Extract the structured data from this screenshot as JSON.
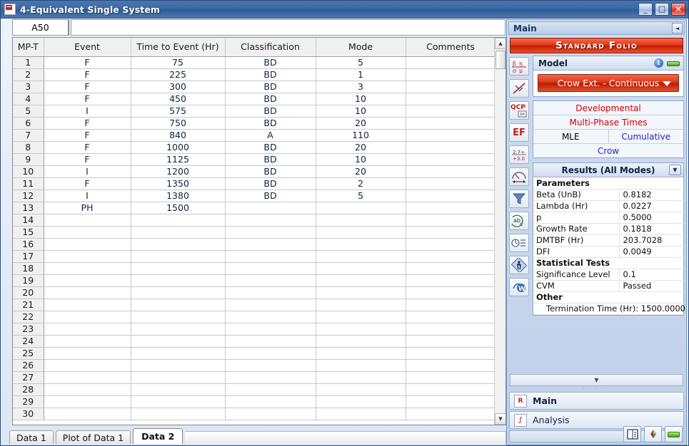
{
  "window": {
    "title": "4-Equivalent Single System",
    "app_icon": "reliasoft-icon",
    "buttons": {
      "minimize": "_",
      "maximize": "□",
      "close": "✕"
    }
  },
  "formula_bar": {
    "cell_ref": "A50",
    "value": "",
    "placeholder": ""
  },
  "grid": {
    "columns": [
      "MP-T",
      "Event",
      "Time to Event (Hr)",
      "Classification",
      "Mode",
      "Comments"
    ],
    "rows": [
      {
        "n": "1",
        "event": "F",
        "time": "75",
        "classification": "BD",
        "mode": "5",
        "comments": ""
      },
      {
        "n": "2",
        "event": "F",
        "time": "225",
        "classification": "BD",
        "mode": "1",
        "comments": ""
      },
      {
        "n": "3",
        "event": "F",
        "time": "300",
        "classification": "BD",
        "mode": "3",
        "comments": ""
      },
      {
        "n": "4",
        "event": "F",
        "time": "450",
        "classification": "BD",
        "mode": "10",
        "comments": ""
      },
      {
        "n": "5",
        "event": "I",
        "time": "575",
        "classification": "BD",
        "mode": "10",
        "comments": ""
      },
      {
        "n": "6",
        "event": "F",
        "time": "750",
        "classification": "BD",
        "mode": "20",
        "comments": ""
      },
      {
        "n": "7",
        "event": "F",
        "time": "840",
        "classification": "A",
        "mode": "110",
        "comments": ""
      },
      {
        "n": "8",
        "event": "F",
        "time": "1000",
        "classification": "BD",
        "mode": "20",
        "comments": ""
      },
      {
        "n": "9",
        "event": "F",
        "time": "1125",
        "classification": "BD",
        "mode": "10",
        "comments": ""
      },
      {
        "n": "10",
        "event": "I",
        "time": "1200",
        "classification": "BD",
        "mode": "20",
        "comments": ""
      },
      {
        "n": "11",
        "event": "F",
        "time": "1350",
        "classification": "BD",
        "mode": "2",
        "comments": ""
      },
      {
        "n": "12",
        "event": "I",
        "time": "1380",
        "classification": "BD",
        "mode": "5",
        "comments": ""
      },
      {
        "n": "13",
        "event": "PH",
        "time": "1500",
        "classification": "",
        "mode": "",
        "comments": ""
      },
      {
        "n": "14",
        "event": "",
        "time": "",
        "classification": "",
        "mode": "",
        "comments": ""
      },
      {
        "n": "15",
        "event": "",
        "time": "",
        "classification": "",
        "mode": "",
        "comments": ""
      },
      {
        "n": "16",
        "event": "",
        "time": "",
        "classification": "",
        "mode": "",
        "comments": ""
      },
      {
        "n": "17",
        "event": "",
        "time": "",
        "classification": "",
        "mode": "",
        "comments": ""
      },
      {
        "n": "18",
        "event": "",
        "time": "",
        "classification": "",
        "mode": "",
        "comments": ""
      },
      {
        "n": "19",
        "event": "",
        "time": "",
        "classification": "",
        "mode": "",
        "comments": ""
      },
      {
        "n": "20",
        "event": "",
        "time": "",
        "classification": "",
        "mode": "",
        "comments": ""
      },
      {
        "n": "21",
        "event": "",
        "time": "",
        "classification": "",
        "mode": "",
        "comments": ""
      },
      {
        "n": "22",
        "event": "",
        "time": "",
        "classification": "",
        "mode": "",
        "comments": ""
      },
      {
        "n": "23",
        "event": "",
        "time": "",
        "classification": "",
        "mode": "",
        "comments": ""
      },
      {
        "n": "24",
        "event": "",
        "time": "",
        "classification": "",
        "mode": "",
        "comments": ""
      },
      {
        "n": "25",
        "event": "",
        "time": "",
        "classification": "",
        "mode": "",
        "comments": ""
      },
      {
        "n": "26",
        "event": "",
        "time": "",
        "classification": "",
        "mode": "",
        "comments": ""
      },
      {
        "n": "27",
        "event": "",
        "time": "",
        "classification": "",
        "mode": "",
        "comments": ""
      },
      {
        "n": "28",
        "event": "",
        "time": "",
        "classification": "",
        "mode": "",
        "comments": ""
      },
      {
        "n": "29",
        "event": "",
        "time": "",
        "classification": "",
        "mode": "",
        "comments": ""
      },
      {
        "n": "30",
        "event": "",
        "time": "",
        "classification": "",
        "mode": "",
        "comments": ""
      }
    ]
  },
  "sheet_tabs": [
    {
      "label": "Data 1",
      "active": false
    },
    {
      "label": "Plot of Data 1",
      "active": false
    },
    {
      "label": "Data 2",
      "active": true
    }
  ],
  "panel": {
    "header_title": "Main",
    "collapse_glyph": "◄",
    "banner": "Standard Folio",
    "icon_rail": [
      "parameters-icon",
      "plot-icon",
      "qcp-icon",
      "ef-icon",
      "calculator-icon",
      "gauge-icon",
      "funnel-icon",
      "abc-transform-icon",
      "timeline-icon",
      "runner-icon",
      "word-export-icon"
    ],
    "model": {
      "title": "Model",
      "info_icon": "info-icon",
      "green_icon": "green-bar-icon",
      "selected": "Crow Ext. - Continuous",
      "dropdown_arrow": "chevron-down-icon"
    },
    "options": {
      "developmental": "Developmental",
      "multi_phase_times": "Multi-Phase Times",
      "mle": "MLE",
      "cumulative": "Cumulative",
      "crow": "Crow"
    },
    "results": {
      "title": "Results (All Modes)",
      "chevron": "chevron-down-icon",
      "rows": [
        {
          "kind": "section",
          "label": "Parameters",
          "value": ""
        },
        {
          "kind": "item",
          "label": "Beta (UnB)",
          "value": "0.8182"
        },
        {
          "kind": "item",
          "label": "Lambda (Hr)",
          "value": "0.0227"
        },
        {
          "kind": "item",
          "label": "p",
          "value": "0.5000"
        },
        {
          "kind": "item",
          "label": "Growth Rate",
          "value": "0.1818"
        },
        {
          "kind": "item",
          "label": "DMTBF (Hr)",
          "value": "203.7028"
        },
        {
          "kind": "item",
          "label": "DFI",
          "value": "0.0049"
        },
        {
          "kind": "section",
          "label": "Statistical Tests",
          "value": ""
        },
        {
          "kind": "item",
          "label": "Significance Level",
          "value": "0.1"
        },
        {
          "kind": "item",
          "label": "CVM",
          "value": "Passed"
        },
        {
          "kind": "section",
          "label": "Other",
          "value": ""
        },
        {
          "kind": "wide",
          "label": "Termination Time (Hr): 1500.0000",
          "value": ""
        }
      ]
    },
    "resize_glyph": "▼",
    "dots": "· · · · ·",
    "nav": [
      {
        "label": "Main",
        "icon": "reliasoft-icon",
        "glyph": "R",
        "bold": true
      },
      {
        "label": "Analysis",
        "icon": "analysis-icon",
        "glyph": "∫",
        "bold": false
      }
    ],
    "footer_buttons": [
      {
        "name": "report-icon",
        "glyph": "▤"
      },
      {
        "name": "color-diamond-icon",
        "glyph": "❖"
      },
      {
        "name": "green-bar-icon",
        "glyph": ""
      }
    ]
  },
  "colors": {
    "titlebar": "#3c6aa6",
    "banner_red": "#c21d05",
    "model_red": "#b81c04",
    "option_red": "#cc0000",
    "option_blue": "#1e28c8"
  }
}
